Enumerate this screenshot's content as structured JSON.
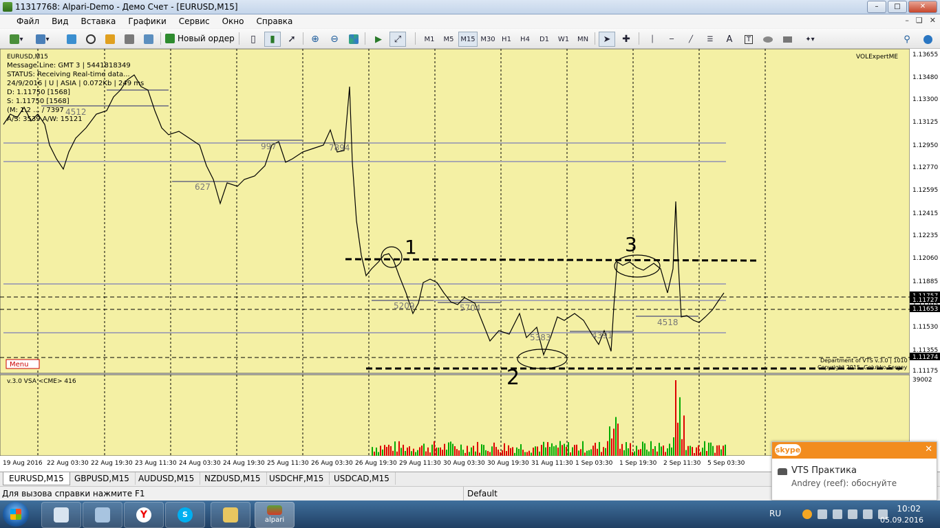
{
  "window": {
    "title": "11317768: Alpari-Demo - Демо Счет - [EURUSD,M15]"
  },
  "menu": [
    "Файл",
    "Вид",
    "Вставка",
    "Графики",
    "Сервис",
    "Окно",
    "Справка"
  ],
  "toolbar": {
    "new_order": "Новый ордер",
    "timeframes": [
      "M1",
      "M5",
      "M15",
      "M30",
      "H1",
      "H4",
      "D1",
      "W1",
      "MN"
    ],
    "active_timeframe": "M15",
    "text_tool": "A",
    "label_tool": "T"
  },
  "chart": {
    "info_lines": [
      "EURUSD,M15",
      "Message Line: GMT 3 | 5441818349",
      "STATUS: Receiving Real-time data...",
      "24/9/2016 | U | ASIA | 0.072Kb | 249 ms",
      "D: 1.11750 [1568]",
      "S: 1.11750 [1568]",
      "(M: 1.2 ... / 7397",
      "A/S: 3539 A/W: 15121"
    ],
    "ea_label": "VOLExpertME",
    "menu_button": "Menu",
    "footer_line1": "Department of VTS v.3.0 | 1010",
    "footer_line2": "Copyright 2015, Golubko Sergey",
    "indicator_label": "v.3.0 VSA <CME> 416",
    "indicator_max": "39002",
    "annotations": {
      "one": "1",
      "two": "2",
      "three": "3"
    },
    "level_labels": [
      "4512",
      "627",
      "997",
      "7894",
      "5209",
      "5704",
      "4518",
      "5383",
      "4391"
    ],
    "price_labels": [
      "1.13655",
      "1.13480",
      "1.13300",
      "1.13125",
      "1.12950",
      "1.12770",
      "1.12595",
      "1.12415",
      "1.12235",
      "1.12060",
      "1.11885",
      "1.11705",
      "1.11530",
      "1.11355",
      "1.11175"
    ],
    "price_tags": [
      {
        "text": "1.11757",
        "color": "#000000"
      },
      {
        "text": "1.11727",
        "color": "#000000"
      },
      {
        "text": "1.11653",
        "color": "#000000"
      },
      {
        "text": "1.11274",
        "color": "#000000"
      }
    ],
    "time_labels": [
      "19 Aug 2016",
      "22 Aug 03:30",
      "22 Aug 19:30",
      "23 Aug 11:30",
      "24 Aug 03:30",
      "24 Aug 19:30",
      "25 Aug 11:30",
      "26 Aug 03:30",
      "26 Aug 19:30",
      "29 Aug 11:30",
      "30 Aug 03:30",
      "30 Aug 19:30",
      "31 Aug 11:30",
      "1 Sep 03:30",
      "1 Sep 19:30",
      "2 Sep 11:30",
      "5 Sep 03:30"
    ],
    "colors": {
      "background": "#f4f0a4",
      "grid": "#000000",
      "candles": "#000000",
      "volume_up": "#00aa00",
      "volume_down": "#dd0000"
    }
  },
  "tabs": [
    "EURUSD,M15",
    "GBPUSD,M15",
    "AUDUSD,M15",
    "NZDUSD,M15",
    "USDCHF,M15",
    "USDCAD,M15"
  ],
  "status": {
    "help": "Для вызова справки нажмите F1",
    "profile": "Default"
  },
  "taskbar": {
    "alpari_label": "alpari",
    "lang": "RU",
    "time": "10:02",
    "date": "05.09.2016"
  },
  "skype_notification": {
    "brand": "skype",
    "title": "VTS Практика",
    "message": "Andrey (reef): обоснуйте"
  }
}
